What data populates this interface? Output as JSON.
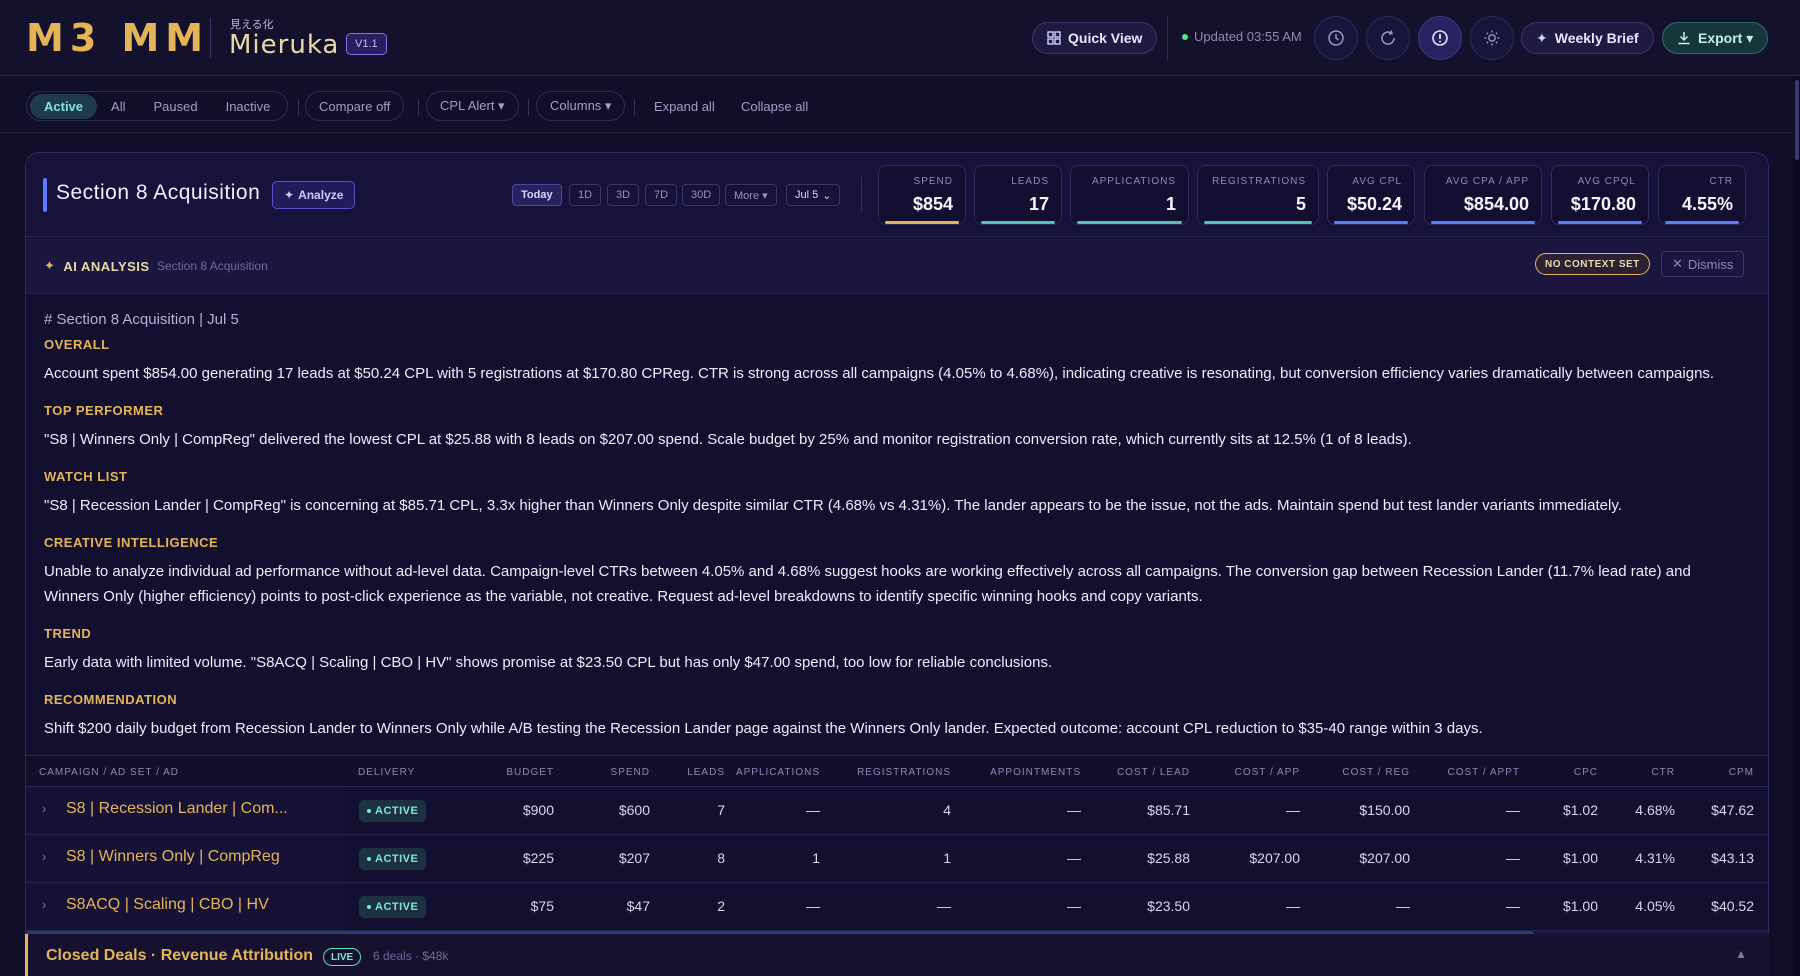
{
  "topbar": {
    "logo": "M3 MM",
    "brand_jp": "見える化",
    "brand_name": "Mieruka",
    "version": "V1.1",
    "quick_view": "Quick View",
    "updated": "Updated 03:55 AM",
    "weekly_brief": "Weekly Brief",
    "export": "Export ▾"
  },
  "filters": {
    "status_tabs": [
      "Active",
      "All",
      "Paused",
      "Inactive"
    ],
    "compare": "Compare off",
    "cpl_alert": "CPL Alert ▾",
    "columns": "Columns ▾",
    "expand_all": "Expand all",
    "collapse_all": "Collapse all"
  },
  "section": {
    "title": "Section 8 Acquisition",
    "analyze": "Analyze",
    "ranges": [
      "Today",
      "1D",
      "3D",
      "7D",
      "30D",
      "More ▾"
    ],
    "date": "Jul 5",
    "kpis": [
      {
        "label": "SPEND",
        "value": "$854"
      },
      {
        "label": "LEADS",
        "value": "17"
      },
      {
        "label": "APPLICATIONS",
        "value": "1"
      },
      {
        "label": "REGISTRATIONS",
        "value": "5"
      },
      {
        "label": "AVG CPL",
        "value": "$50.24"
      },
      {
        "label": "AVG CPA / APP",
        "value": "$854.00"
      },
      {
        "label": "AVG CPQL",
        "value": "$170.80"
      },
      {
        "label": "CTR",
        "value": "4.55%"
      }
    ]
  },
  "ai": {
    "title": "AI ANALYSIS",
    "subtitle": "Section 8 Acquisition",
    "context_badge": "NO CONTEXT SET",
    "dismiss": "Dismiss",
    "heading": "# Section 8 Acquisition | Jul 5",
    "sections": [
      {
        "title": "OVERALL",
        "body": "Account spent $854.00 generating 17 leads at $50.24 CPL with 5 registrations at $170.80 CPReg. CTR is strong across all campaigns (4.05% to 4.68%), indicating creative is resonating, but conversion efficiency varies dramatically between campaigns."
      },
      {
        "title": "TOP PERFORMER",
        "body": "\"S8 | Winners Only | CompReg\" delivered the lowest CPL at $25.88 with 8 leads on $207.00 spend. Scale budget by 25% and monitor registration conversion rate, which currently sits at 12.5% (1 of 8 leads)."
      },
      {
        "title": "WATCH LIST",
        "body": "\"S8 | Recession Lander | CompReg\" is concerning at $85.71 CPL, 3.3x higher than Winners Only despite similar CTR (4.68% vs 4.31%). The lander appears to be the issue, not the ads. Maintain spend but test lander variants immediately."
      },
      {
        "title": "CREATIVE INTELLIGENCE",
        "body": "Unable to analyze individual ad performance without ad-level data. Campaign-level CTRs between 4.05% and 4.68% suggest hooks are working effectively across all campaigns. The conversion gap between Recession Lander (11.7% lead rate) and Winners Only (higher efficiency) points to post-click experience as the variable, not creative. Request ad-level breakdowns to identify specific winning hooks and copy variants."
      },
      {
        "title": "TREND",
        "body": "Early data with limited volume. \"S8ACQ | Scaling | CBO | HV\" shows promise at $23.50 CPL but has only $47.00 spend, too low for reliable conclusions."
      },
      {
        "title": "RECOMMENDATION",
        "body": "Shift $200 daily budget from Recession Lander to Winners Only while A/B testing the Recession Lander page against the Winners Only lander. Expected outcome: account CPL reduction to $35-40 range within 3 days."
      }
    ]
  },
  "table": {
    "headers": [
      "CAMPAIGN / AD SET / AD",
      "DELIVERY",
      "BUDGET",
      "SPEND",
      "LEADS",
      "APPLICATIONS",
      "REGISTRATIONS",
      "APPOINTMENTS",
      "COST / LEAD",
      "COST / APP",
      "COST / REG",
      "COST / APPT",
      "CPC",
      "CTR",
      "CPM"
    ],
    "rows": [
      {
        "name": "S8 | Recession Lander | Com...",
        "delivery": "ACTIVE",
        "cells": [
          "$900",
          "$600",
          "7",
          "—",
          "4",
          "—",
          "$85.71",
          "—",
          "$150.00",
          "—",
          "$1.02",
          "4.68%",
          "$47.62"
        ]
      },
      {
        "name": "S8 | Winners Only | CompReg",
        "delivery": "ACTIVE",
        "cells": [
          "$225",
          "$207",
          "8",
          "1",
          "1",
          "—",
          "$25.88",
          "$207.00",
          "$207.00",
          "—",
          "$1.00",
          "4.31%",
          "$43.13"
        ]
      },
      {
        "name": "S8ACQ | Scaling | CBO | HV",
        "delivery": "ACTIVE",
        "cells": [
          "$75",
          "$47",
          "2",
          "—",
          "—",
          "—",
          "$23.50",
          "—",
          "—",
          "—",
          "$1.00",
          "4.05%",
          "$40.52"
        ]
      }
    ]
  },
  "closed_deals": {
    "title": "Closed Deals · Revenue Attribution",
    "badge": "LIVE",
    "sub": "6 deals · $48k"
  },
  "colors": {
    "accent_gold": "#e6b458",
    "active_teal": "#7ee6d8",
    "accent_blue": "#5b7cff"
  }
}
